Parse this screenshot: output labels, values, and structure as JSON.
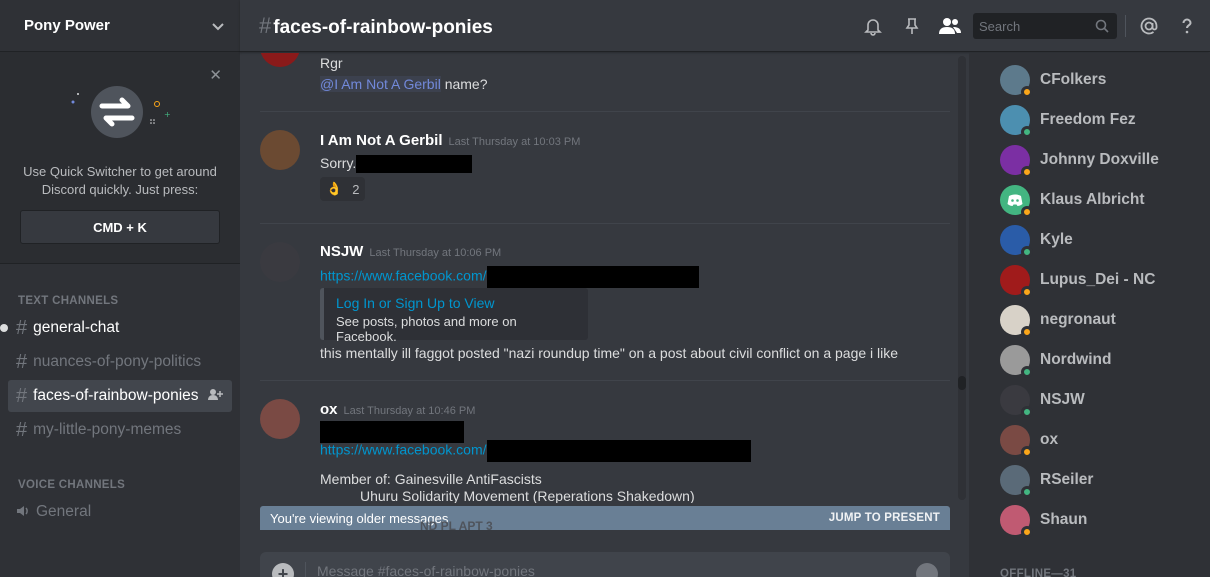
{
  "server": {
    "name": "Pony Power"
  },
  "quick_switcher": {
    "text": "Use Quick Switcher to get around Discord quickly. Just press:",
    "shortcut": "CMD + K"
  },
  "text_channels_label": "TEXT CHANNELS",
  "text_channels": [
    {
      "name": "general-chat",
      "state": "unread"
    },
    {
      "name": "nuances-of-pony-politics",
      "state": "normal"
    },
    {
      "name": "faces-of-rainbow-ponies",
      "state": "selected"
    },
    {
      "name": "my-little-pony-memes",
      "state": "normal"
    }
  ],
  "voice_channels_label": "VOICE CHANNELS",
  "voice_channels": [
    {
      "name": "General"
    }
  ],
  "header": {
    "hash": "#",
    "channel": "faces-of-rainbow-ponies",
    "search_placeholder": "Search"
  },
  "messages": [
    {
      "author": "",
      "lines": [
        "Rgr"
      ],
      "mention": "@I Am Not A Gerbil",
      "mention_tail": " name?",
      "avatar_color": "#8a1a1a"
    },
    {
      "author": "I Am Not A Gerbil",
      "timestamp": "Last Thursday at 10:03 PM",
      "text": "Sorry.",
      "reaction": {
        "emoji": "👌",
        "count": "2"
      },
      "avatar_color": "#6b4a32"
    },
    {
      "author": "NSJW",
      "timestamp": "Last Thursday at 10:06 PM",
      "link": "https://www.facebook.com/",
      "embed": {
        "title": "Log In or Sign Up to View",
        "description": "See posts, photos and more on Facebook."
      },
      "text": "this mentally ill faggot posted \"nazi roundup time\" on a post about civil conflict on a page i like",
      "avatar_color": "#3a3a40"
    },
    {
      "author": "ox",
      "timestamp": "Last Thursday at 10:46 PM",
      "link": "https://www.facebook.com/",
      "member_line_1": "Member of:  Gainesville AntiFascists",
      "member_line_2": "Uhuru Solidarity Movement (Reperations Shakedown)",
      "avatar_color": "#7a4a44"
    }
  ],
  "older_bar": {
    "text": "You're viewing older messages",
    "jump": "JUMP TO PRESENT",
    "ghost": "ND PL APT 3"
  },
  "composer": {
    "placeholder": "Message #faces-of-rainbow-ponies"
  },
  "members": [
    {
      "name": "CFolkers",
      "status": "idle",
      "avatar_color": "#5d7a8c"
    },
    {
      "name": "Freedom Fez",
      "status": "online",
      "avatar_color": "#4c8fb0"
    },
    {
      "name": "Johnny Doxville",
      "status": "idle",
      "avatar_color": "#7b2fa3"
    },
    {
      "name": "Klaus Albricht",
      "status": "idle",
      "avatar_color": "#43b581"
    },
    {
      "name": "Kyle",
      "status": "online",
      "avatar_color": "#2a5ca8"
    },
    {
      "name": "Lupus_Dei - NC",
      "status": "idle",
      "avatar_color": "#a01b1b"
    },
    {
      "name": "negronaut",
      "status": "idle",
      "avatar_color": "#d8d2c8"
    },
    {
      "name": "Nordwind",
      "status": "online",
      "avatar_color": "#9a9a9a"
    },
    {
      "name": "NSJW",
      "status": "online",
      "avatar_color": "#3a3a40"
    },
    {
      "name": "ox",
      "status": "idle",
      "avatar_color": "#7a4a44"
    },
    {
      "name": "RSeiler",
      "status": "online",
      "avatar_color": "#5a6a78"
    },
    {
      "name": "Shaun",
      "status": "idle",
      "avatar_color": "#c05a72"
    }
  ],
  "offline_label": "OFFLINE—31",
  "colors": {
    "online": "#43b581",
    "idle": "#faa61a",
    "accent": "#7289da",
    "link": "#0096cf"
  }
}
